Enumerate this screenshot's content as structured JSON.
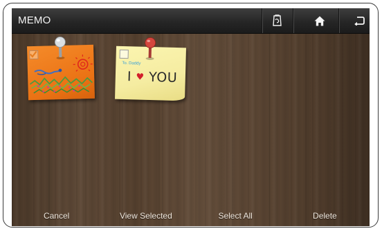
{
  "header": {
    "title": "MEMO",
    "buttons": [
      {
        "icon": "memo-edit-icon"
      },
      {
        "icon": "home-icon"
      },
      {
        "icon": "back-arrow-icon"
      }
    ]
  },
  "memos": [
    {
      "color": "orange",
      "checked": true,
      "pin_color": "silver"
    },
    {
      "color": "yellow",
      "checked": false,
      "pin_color": "red",
      "to_text": "To. Daddy",
      "message": "I ♥ YOU",
      "message_parts": [
        "I",
        "YOU"
      ]
    }
  ],
  "toolbar": {
    "cancel": "Cancel",
    "view_selected": "View Selected",
    "select_all": "Select All",
    "delete": "Delete"
  },
  "colors": {
    "accent_heart": "#d21f2b",
    "to_text": "#3aa0d8",
    "checkmark": "#e67e22"
  }
}
